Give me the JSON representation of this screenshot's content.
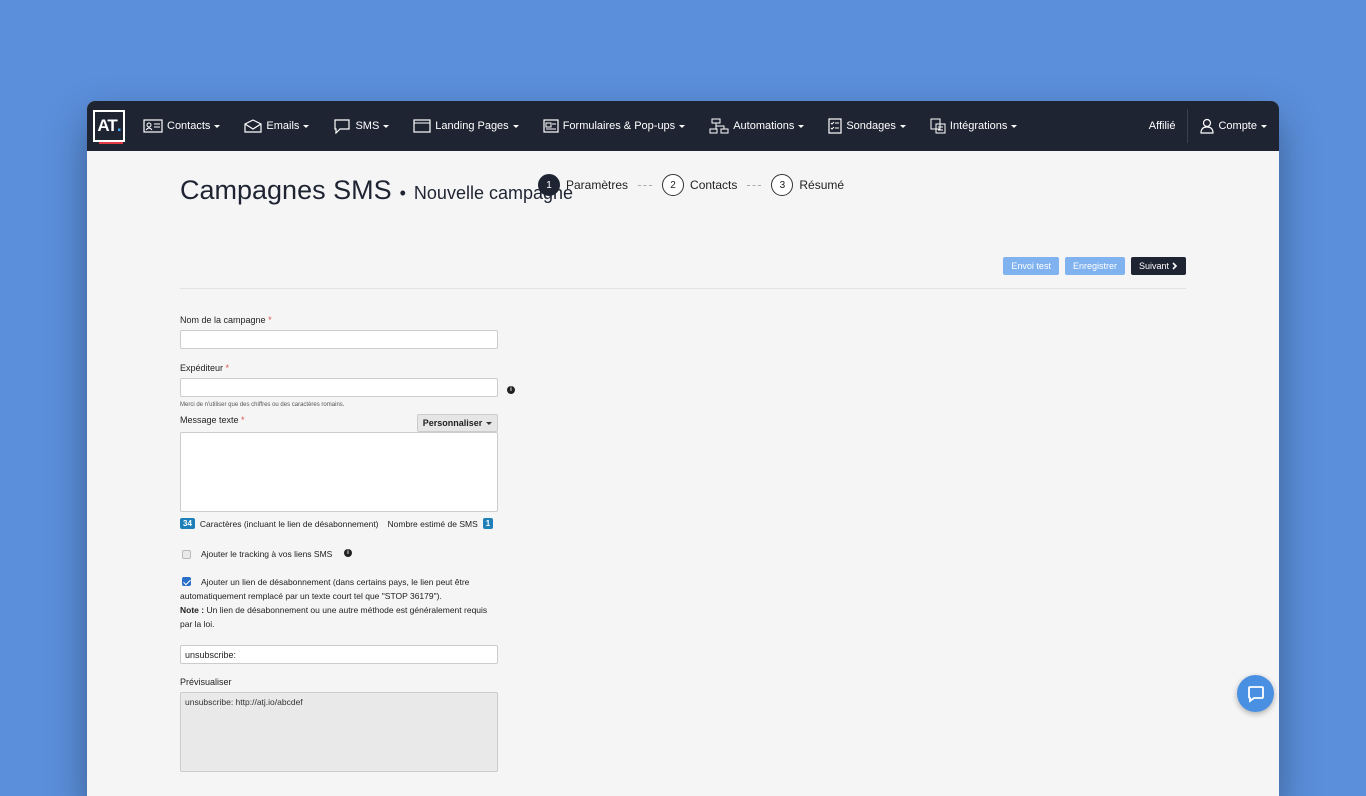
{
  "app": {
    "logo_text": "AT",
    "logo_dot": ".",
    "brand_colors": {
      "nav": "#1f2433",
      "accent": "#3fa9f5",
      "button_light": "#7fb2ef",
      "badge": "#1f7fb8"
    }
  },
  "nav": {
    "items": [
      {
        "label": "Contacts",
        "icon": "contacts-card-icon"
      },
      {
        "label": "Emails",
        "icon": "envelope-icon"
      },
      {
        "label": "SMS",
        "icon": "chat-bubble-icon"
      },
      {
        "label": "Landing Pages",
        "icon": "browser-window-icon"
      },
      {
        "label": "Formulaires & Pop-ups",
        "icon": "form-icon"
      },
      {
        "label": "Automations",
        "icon": "workflow-icon"
      },
      {
        "label": "Sondages",
        "icon": "survey-icon"
      },
      {
        "label": "Intégrations",
        "icon": "integrations-icon"
      }
    ],
    "affilie": "Affilié",
    "compte": "Compte"
  },
  "page": {
    "title": "Campagnes SMS",
    "bullet": "•",
    "subtitle": "Nouvelle campagne"
  },
  "steps": [
    {
      "number": "1",
      "label": "Paramètres",
      "active": true
    },
    {
      "number": "2",
      "label": "Contacts",
      "active": false
    },
    {
      "number": "3",
      "label": "Résumé",
      "active": false
    }
  ],
  "actions": {
    "envoi_test": "Envoi test",
    "enregistrer": "Enregistrer",
    "suivant": "Suivant"
  },
  "form": {
    "campaign_name_label": "Nom de la campagne",
    "required_mark": "*",
    "campaign_name_value": "",
    "sender_label": "Expéditeur",
    "sender_value": "",
    "sender_help": "Merci de n'utiliser que des chiffres ou des caractères romains.",
    "info_glyph": "i",
    "message_label": "Message texte",
    "personaliser_label": "Personnaliser",
    "message_value": "",
    "char_count": "34",
    "char_count_label": "Caractères (incluant le lien de désabonnement)",
    "sms_count_label": "Nombre estimé de SMS",
    "sms_count": "1",
    "tracking_label": "Ajouter le tracking à vos liens SMS",
    "tracking_checked": false,
    "unsubscribe_label": "Ajouter un lien de désabonnement (dans certains pays, le lien peut être automatiquement remplacé par un texte court tel que \"STOP 36179\").",
    "unsubscribe_checked": true,
    "note_prefix": "Note :",
    "note_text": "Un lien de désabonnement ou une autre méthode est généralement requis par la loi.",
    "unsubscribe_value": "unsubscribe:",
    "preview_label": "Prévisualiser",
    "preview_text": "unsubscribe:  http://atj.io/abcdef"
  }
}
